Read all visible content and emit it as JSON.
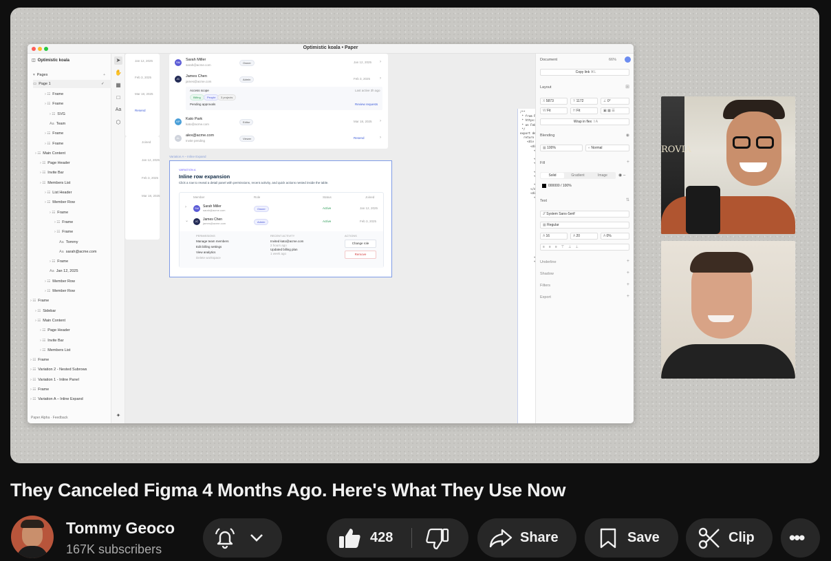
{
  "video": {
    "title": "They Canceled Figma 4 Months Ago. Here's What They Use Now"
  },
  "channel": {
    "name": "Tommy Geoco",
    "subscribers": "167K subscribers"
  },
  "actions": {
    "likes": "428",
    "share": "Share",
    "save": "Save",
    "clip": "Clip"
  },
  "app": {
    "window_title": "Optimistic koala • Paper",
    "file_name": "Optimistic koala",
    "pages_label": "Pages",
    "page1": "Page 1",
    "layers": [
      {
        "label": "Frame",
        "indent": 3
      },
      {
        "label": "Frame",
        "indent": 3
      },
      {
        "label": "SVG",
        "indent": 4
      },
      {
        "label": "Team",
        "indent": 4
      },
      {
        "label": "Frame",
        "indent": 3
      },
      {
        "label": "Frame",
        "indent": 3
      },
      {
        "label": "Main Content",
        "indent": 1
      },
      {
        "label": "Page Header",
        "indent": 2
      },
      {
        "label": "Invite Bar",
        "indent": 2
      },
      {
        "label": "Members List",
        "indent": 2
      },
      {
        "label": "List Header",
        "indent": 3
      },
      {
        "label": "Member Row",
        "indent": 3
      },
      {
        "label": "Frame",
        "indent": 4
      },
      {
        "label": "Frame",
        "indent": 5
      },
      {
        "label": "Frame",
        "indent": 5
      },
      {
        "label": "Tommy",
        "indent": 6
      },
      {
        "label": "sarah@acme.com",
        "indent": 6
      },
      {
        "label": "Frame",
        "indent": 4
      },
      {
        "label": "Jan 12, 2025",
        "indent": 4
      },
      {
        "label": "Member Row",
        "indent": 3
      },
      {
        "label": "Member Row",
        "indent": 3
      },
      {
        "label": "Frame",
        "indent": 0
      },
      {
        "label": "Sidebar",
        "indent": 1
      },
      {
        "label": "Main Content",
        "indent": 1
      },
      {
        "label": "Page Header",
        "indent": 2
      },
      {
        "label": "Invite Bar",
        "indent": 2
      },
      {
        "label": "Members List",
        "indent": 2
      },
      {
        "label": "Frame",
        "indent": 0
      },
      {
        "label": "Variation 2 - Nested Subrows",
        "indent": 0
      },
      {
        "label": "Variation 1 - Inline Panel",
        "indent": 0
      },
      {
        "label": "Frame",
        "indent": 0
      },
      {
        "label": "Variation A – Inline Expand",
        "indent": 0
      },
      {
        "label": "/** * from Paper *...",
        "indent": 0
      }
    ],
    "footer": "Paper Alpha · Feedback",
    "canvas": {
      "top_rows": [
        {
          "initials": "SM",
          "name": "Sarah Miller",
          "email": "sarah@acme.com",
          "role": "Owner",
          "date": "Jan 12, 2025",
          "color": "#5b5bd6"
        },
        {
          "initials": "JC",
          "name": "James Chen",
          "email": "james@acme.com",
          "role": "Admin",
          "date": "Feb 3, 2025",
          "color": "#222a55"
        }
      ],
      "access_scope": "Access scope",
      "scope_tags": [
        "Billing",
        "People",
        "3 projects"
      ],
      "last_active": "Last active 3h ago",
      "pending": "Pending approvals",
      "review": "Review requests",
      "bottom_rows": [
        {
          "initials": "KP",
          "name": "Kato Park",
          "email": "kato@acme.com",
          "role": "Editor",
          "date": "Mar 18, 2025",
          "color": "#4a9fd8"
        },
        {
          "initials": "AL",
          "name": "alex@acme.com",
          "email": "Invite pending",
          "role": "Viewer",
          "date": "Resend",
          "color": "#cfd3dc"
        }
      ],
      "left_dates": [
        "Jan 12, 2025",
        "Feb 3, 2025",
        "Mar 18, 2025",
        "Resend"
      ],
      "left_dates2": [
        "Joined",
        "Jan 12, 2025",
        "Feb 3, 2025",
        "Mar 18, 2025"
      ],
      "variation_label": "Variation A – Inline Expand",
      "var": {
        "kicker": "VARIATION A",
        "title": "Inline row expansion",
        "desc": "Click a row to reveal a detail panel with permissions, recent activity, and quick actions nested inside the table.",
        "cols": [
          "Member",
          "Role",
          "Status",
          "Joined"
        ],
        "rows": [
          {
            "initials": "SM",
            "name": "Sarah Miller",
            "email": "sarah@acme.com",
            "role": "Owner",
            "status": "Active",
            "date": "Jan 12, 2025",
            "color": "#5b5bd6"
          },
          {
            "initials": "JC",
            "name": "James Chen",
            "email": "james@acme.com",
            "role": "Admin",
            "status": "Active",
            "date": "Feb 3, 2025",
            "color": "#222a55"
          }
        ],
        "perm_head": "PERMISSIONS",
        "perms": [
          "Manage team members",
          "Edit billing settings",
          "View analytics",
          "Delete workspace"
        ],
        "act_head": "RECENT ACTIVITY",
        "acts": [
          "Invited kato@acme.com",
          "2 hours ago",
          "Updated billing plan",
          "1 week ago"
        ],
        "actions_head": "ACTIONS",
        "change": "Change role",
        "remove": "Remove"
      }
    },
    "code": "/**\n * from Paper\n * https://app.paper.design/file/01KHFCWTJ5MYDNKSAHJVZ6YFC\n * on Feb 17, 2026\n */\nexport default function () {\n  return (\n    <div style={{ backgroundColor: '#F6F9FC', boxSizing: 'border-box',\n      <div style={{ boxSizing: 'border-box', display: 'flex', flexDirection:\n        <div style={{ boxSizing: 'border-box', color: '#6355FF', display:\n          Variation A\n        </div>\n        <div style={{ boxSizing: 'border-box', color: '#0A2540', display:\n          Inline row expansion\n        </div>\n        <div style={{ boxSizing: 'border-box', color: '#425466', display:\n          Click a row to reveal a detail panel with permissions, recent act\n        </div>\n      </div>\n      <div style={{ backgroundColor: '#FFFFFF', borderColor: '#E6EBF1'\n        <div style={{ alignItems: 'center', borderBottomColor: '#E6EBF1'\n          <div style={{ boxSizing: 'border-box', display: 'inline-block', fle\n          <div style={{ boxSizing: 'border-box', color: '#8898AA', display\n            Member\n          </div>\n          <div style={{ boxSizing: 'border-box', color: '#8898AA', display\n            Role\n          </div>\n          <div style={{ boxSizing: 'border-box', color: '#8898AA', display\n            Status\n          </div>\n          <div style={{ boxSizing: 'border-box', color: '#8898AA', display\n            Joined\n          </div>\n        </div>\n        <div style={{ alignItems: 'center', borderBottomColor: '#E6EBF1'\n          <div style={{ alignItems: 'center', boxSizing: 'border-box', di\n            <svg width=\"14\" height=\"14\" viewBox=\"0 0 14 14\" fill=\"none\"\n              <path d=\"M5 3.5L8 7L5 10.5\" stroke=\"#8898AA\" strokeWidt\n            </svg>\n          </div>\n          <div style={{ alignItems: 'center', boxSizing: 'border-box', displ\n            <div style={{ alignItems: 'center', backgroundColor: '#6355FF\n              <div style={{ boxSizing: 'border-box', color: '#FFFFFF', disp\n                SM\n              </div>\n            </div>\n            <div style={{ boxSizing: 'border-box', display: 'flex', flexDirect\n              <div style={{ boxSizing: 'border-box', color: '#0A2540', displ\n                Sarah Miller\n              </div>\n              <div style={{ boxSizing: 'border-box', color: '#8898AA', displ\n                sarah@acme.com\n              </div>\n            </div>\n          </div>\n          <div style={{ alignItems: 'center', boxSizing: 'border-box', displ\n            <div style={{ backgroundColor: '#6355FF14', borderRadius: '9\n              <div style={{ boxSizing: 'border-box', color: '#6355FF', displ\n                Owner\n              </div>\n            </div>\n          </div>\n          <div style={{ alignItems: 'center', boxSizing: 'border-box', displ\n            <div style={{ backgroundColor: '#33C172', borderRadius: '50\n              <div style={{ boxSizing: 'border-box', color: '#425466', displ\n                Active\n              </div>\n            </div>",
    "props": {
      "document": "Document",
      "zoom": "66%",
      "copy_link": "Copy link",
      "copy_shortcut": "⌘L",
      "layout": "Layout",
      "x": "5873",
      "y": "1172",
      "rot": "0°",
      "w": "Fit",
      "h": "Fit",
      "wrap": "Wrap in flex",
      "wrap_key": "⇧A",
      "blending": "Blending",
      "opacity": "100%",
      "blend_mode": "Normal",
      "fill": "Fill",
      "fill_tabs": [
        "Solid",
        "Gradient",
        "Image"
      ],
      "fill_value": "000000",
      "fill_opacity": "100%",
      "text": "Text",
      "font": "System Sans-Serif",
      "weight": "Regular",
      "size": "16",
      "line": "20",
      "tracking": "0%",
      "sections": [
        "Underline",
        "Shadow",
        "Filters",
        "Export"
      ]
    }
  },
  "colors": {
    "bg": "#0f0f0f",
    "button": "#272727",
    "text": "#f1f1f1",
    "muted": "#aaaaaa",
    "accent": "#3c5bd8"
  }
}
